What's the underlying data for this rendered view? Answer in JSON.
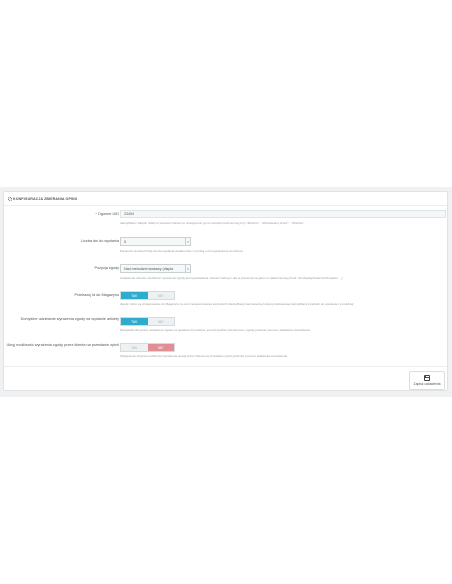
{
  "panel": {
    "title": "KONFIGURACJA ZBIERANIA OPINII"
  },
  "fields": {
    "shop_id": {
      "required_mark": "*",
      "label": "Ogonne UID",
      "value": "23454",
      "help": "Identyfikator Sklepu (UID) w serwisie Opineo.pl, dostępność go w instrukcji technicznej przy \"Zbiórka\" - \"Zbudowano przez\" - \"Zbiórka\""
    },
    "days": {
      "label": "Liczba dni do wysłania",
      "value": "5",
      "help": "Parametr określa liczbę dni do wysłania wiadomości z prośbą o ich wypełnienie do klienta"
    },
    "position": {
      "label": "Pozycja zgody",
      "value": "Nad metodami dostawy (displa",
      "help": "Ustawienia określa możliwość wyrażenia zgody jest wyświetlana również ważnym dla w prezencji za jakim to wiadomością (hook: hk=displayOrderConfirmation ...)"
    },
    "send_to_shop": {
      "label": "Przekazuj id do Magazynu",
      "yes": "TAK",
      "no": "NIE",
      "state": "yes",
      "help": "Zgody, które są zintegrowane do Magazynu w celu zarejestrowania wszystkich identyfikacji zamówienia (usługi podstawowej identyfikacji produktu do wysłania z produktu)"
    },
    "default_consent": {
      "label": "Domyślne udzielanie wyrażenia zgody na wysłanie ankiety",
      "yes": "TAK",
      "no": "NIE",
      "state": "yes",
      "help": "Wyświetla domyślne ustawienie zgody na wysłanie formularza, jest domyślnie zaznaczone i zgody podczas procesu składania zamówienia"
    },
    "hide_consent": {
      "label": "Ukryj możliwość wyrażenia zgody przez klienta na przesłanie opinii",
      "yes": "TAK",
      "no": "NIE",
      "state": "no",
      "help": "Wyłączenie ukrycia możliwości wyrażenia zgody przez klienta na przesłanie opinii podczas procesu składania zamówienia"
    }
  },
  "footer": {
    "save_label": "Zapisz ustawienia"
  }
}
